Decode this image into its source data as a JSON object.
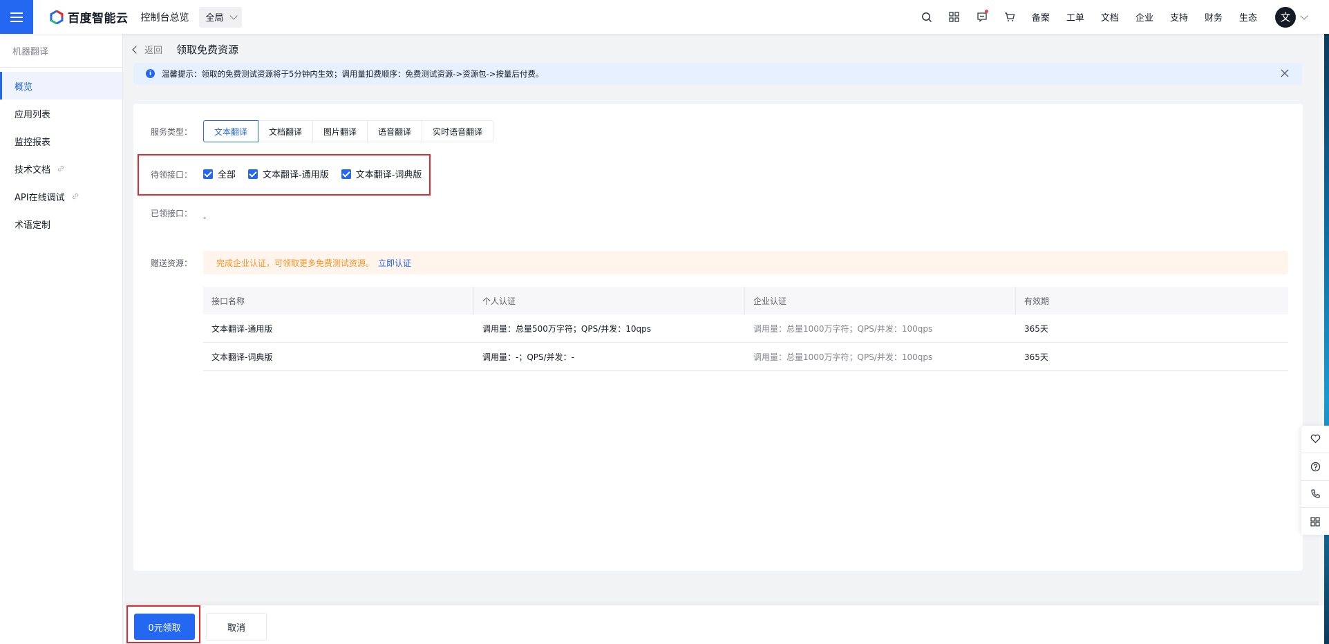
{
  "header": {
    "logo_text": "百度智能云",
    "nav_overview": "控制台总览",
    "region": "全局",
    "right_links": [
      "备案",
      "工单",
      "文档",
      "企业",
      "支持",
      "财务",
      "生态"
    ],
    "avatar_char": "文"
  },
  "sidebar": {
    "title": "机器翻译",
    "items": [
      {
        "label": "概览",
        "active": true
      },
      {
        "label": "应用列表"
      },
      {
        "label": "监控报表"
      },
      {
        "label": "技术文档",
        "external": true
      },
      {
        "label": "API在线调试",
        "external": true
      },
      {
        "label": "术语定制"
      }
    ]
  },
  "page": {
    "back": "返回",
    "title": "领取免费资源",
    "tip": "温馨提示：领取的免费测试资源将于5分钟内生效；调用量扣费顺序：免费测试资源->资源包->按量后付费。"
  },
  "form": {
    "service_type_label": "服务类型：",
    "service_tabs": [
      "文本翻译",
      "文档翻译",
      "图片翻译",
      "语音翻译",
      "实时语音翻译"
    ],
    "active_tab": "文本翻译",
    "pending_label": "待领接口：",
    "checkboxes": [
      {
        "label": "全部",
        "checked": true
      },
      {
        "label": "文本翻译-通用版",
        "checked": true
      },
      {
        "label": "文本翻译-词典版",
        "checked": true
      }
    ],
    "received_label": "已领接口：",
    "received_value": "-",
    "gift_label": "赠送资源：",
    "promo_text": "完成企业认证，可领取更多免费测试资源。",
    "promo_link": "立即认证"
  },
  "table": {
    "headers": [
      "接口名称",
      "个人认证",
      "企业认证",
      "有效期"
    ],
    "rows": [
      [
        "文本翻译-通用版",
        "调用量：总量500万字符；QPS/并发：10qps",
        "调用量：总量1000万字符；QPS/并发：100qps",
        "365天"
      ],
      [
        "文本翻译-词典版",
        "调用量：-；QPS/并发：-",
        "调用量：总量1000万字符；QPS/并发：100qps",
        "365天"
      ]
    ]
  },
  "footer": {
    "confirm": "0元领取",
    "cancel": "取消"
  },
  "colors": {
    "primary": "#2468f2",
    "highlight": "#e8262c",
    "promo_text": "#ff9326",
    "tip_bg": "#e6f0ff"
  },
  "icons": [
    "menu-icon",
    "search-icon",
    "apps-icon",
    "message-icon",
    "cart-icon",
    "info-icon",
    "close-icon",
    "link-icon",
    "heart-icon",
    "help-icon",
    "phone-icon",
    "grid-icon"
  ]
}
